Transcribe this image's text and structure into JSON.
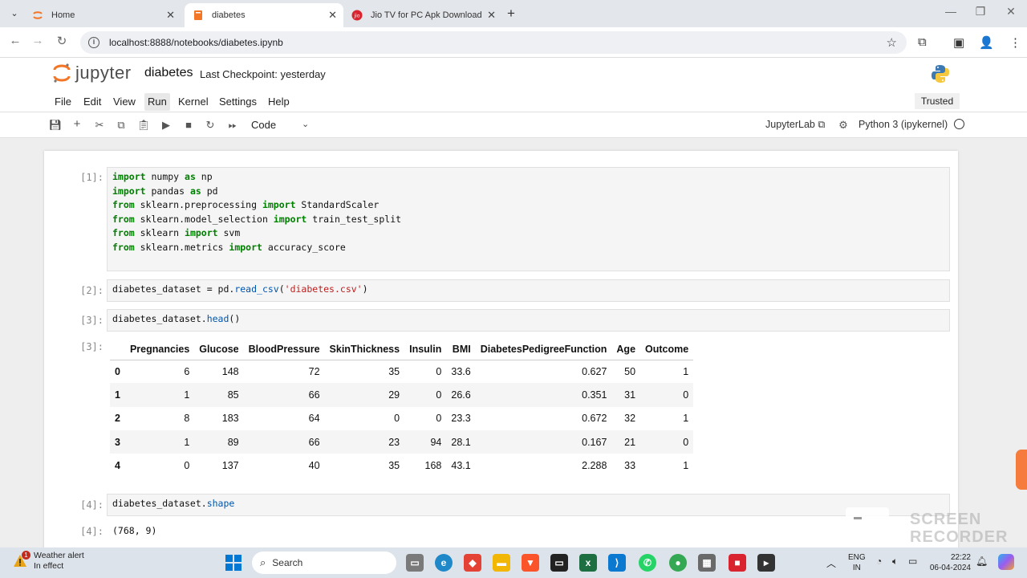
{
  "browser": {
    "tabs": [
      {
        "label": "Home",
        "active": false
      },
      {
        "label": "diabetes",
        "active": true
      },
      {
        "label": "Jio TV for PC Apk Download",
        "active": false
      }
    ],
    "url": "localhost:8888/notebooks/diabetes.ipynb"
  },
  "jupyter": {
    "logo_text": "jupyter",
    "notebook_title": "diabetes",
    "checkpoint": "Last Checkpoint: yesterday",
    "menu": [
      "File",
      "Edit",
      "View",
      "Run",
      "Kernel",
      "Settings",
      "Help"
    ],
    "active_menu": "Run",
    "trusted": "Trusted",
    "cell_type": "Code",
    "jupyterlab_link": "JupyterLab",
    "kernel": "Python 3 (ipykernel)"
  },
  "cells": {
    "c1_prompt": "[1]:",
    "c1_lines": [
      [
        "import",
        " numpy ",
        "as",
        " np"
      ],
      [
        "import",
        " pandas ",
        "as",
        " pd"
      ],
      [
        "from",
        " sklearn.preprocessing ",
        "import",
        " StandardScaler"
      ],
      [
        "from",
        " sklearn.model_selection ",
        "import",
        " train_test_split"
      ],
      [
        "from",
        " sklearn ",
        "import",
        " svm"
      ],
      [
        "from",
        " sklearn.metrics ",
        "import",
        " accuracy_score"
      ]
    ],
    "c2_prompt": "[2]:",
    "c2_var": "diabetes_dataset",
    "c2_eq": " = pd.",
    "c2_fn": "read_csv",
    "c2_str": "'diabetes.csv'",
    "c3_prompt": "[3]:",
    "c3_var": "diabetes_dataset.",
    "c3_fn": "head",
    "c3_tail": "()",
    "c3_out_prompt": "[3]:",
    "c4_prompt": "[4]:",
    "c4_var": "diabetes_dataset.",
    "c4_fn": "shape",
    "c4_out_prompt": "[4]:",
    "c4_out": "(768, 9)"
  },
  "table": {
    "columns": [
      "",
      "Pregnancies",
      "Glucose",
      "BloodPressure",
      "SkinThickness",
      "Insulin",
      "BMI",
      "DiabetesPedigreeFunction",
      "Age",
      "Outcome"
    ],
    "rows": [
      [
        "0",
        "6",
        "148",
        "72",
        "35",
        "0",
        "33.6",
        "0.627",
        "50",
        "1"
      ],
      [
        "1",
        "1",
        "85",
        "66",
        "29",
        "0",
        "26.6",
        "0.351",
        "31",
        "0"
      ],
      [
        "2",
        "8",
        "183",
        "64",
        "0",
        "0",
        "23.3",
        "0.672",
        "32",
        "1"
      ],
      [
        "3",
        "1",
        "89",
        "66",
        "23",
        "94",
        "28.1",
        "0.167",
        "21",
        "0"
      ],
      [
        "4",
        "0",
        "137",
        "40",
        "35",
        "168",
        "43.1",
        "2.288",
        "33",
        "1"
      ]
    ]
  },
  "overlay": {
    "recorder_line1": "SCREEN",
    "recorder_line2": "RECORDER"
  },
  "taskbar": {
    "weather_title": "Weather alert",
    "weather_sub": "In effect",
    "weather_badge": "1",
    "search": "Search",
    "lang1": "ENG",
    "lang2": "IN",
    "time": "22:22",
    "date": "06-04-2024"
  }
}
